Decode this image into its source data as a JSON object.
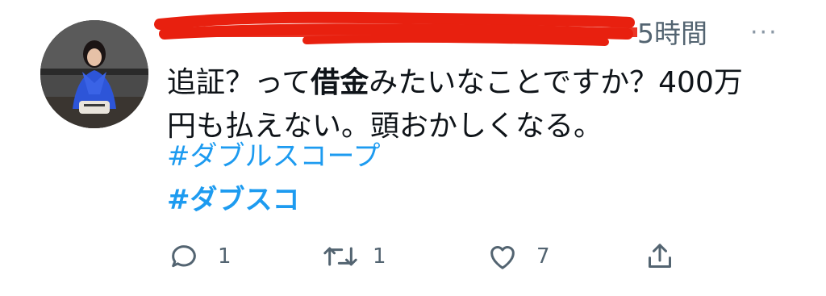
{
  "tweet": {
    "time": "5時間",
    "more_label": "···",
    "text_parts": [
      "追証？って",
      "借金",
      "みたいなことですか？400万",
      "円も払えない。頭おかしくなる。"
    ],
    "hashtags": [
      "#ダブルスコープ",
      "#ダブスコ"
    ]
  },
  "actions": {
    "reply_count": "1",
    "retweet_count": "1",
    "like_count": "7"
  },
  "colors": {
    "link": "#1d9bf0",
    "redaction": "#e8200f",
    "icon": "#536471"
  },
  "icons": [
    "reply-icon",
    "retweet-icon",
    "like-icon",
    "share-icon",
    "more-icon"
  ]
}
